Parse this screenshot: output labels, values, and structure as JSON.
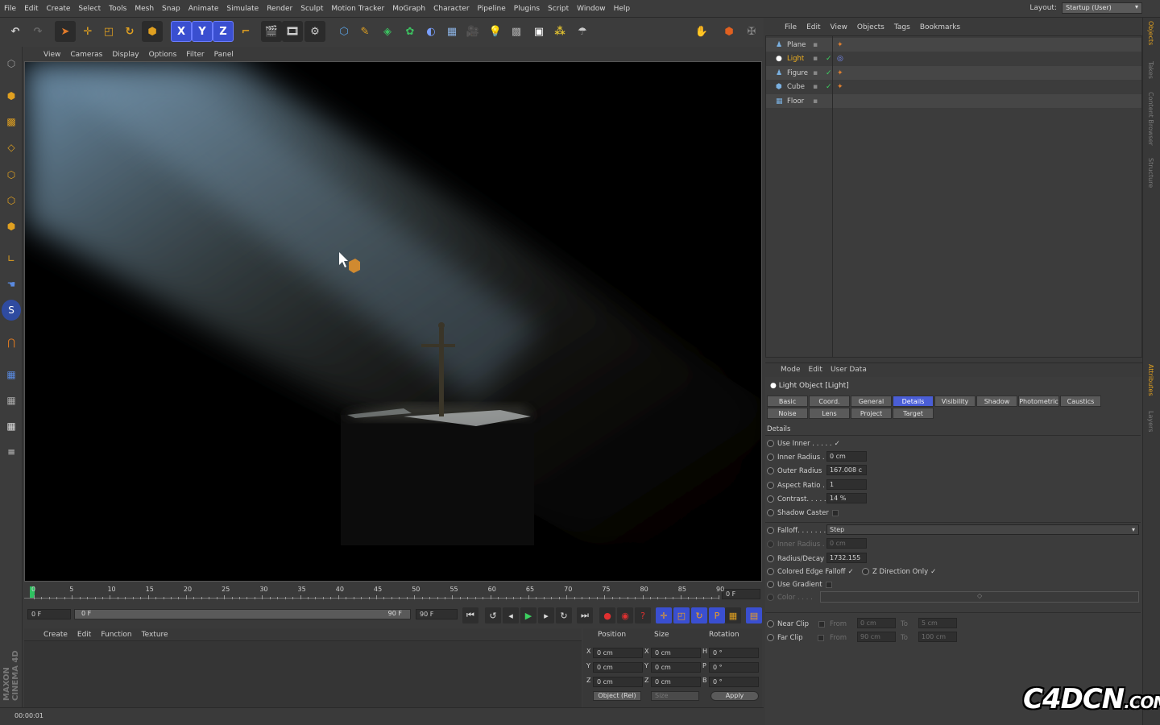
{
  "menubar": [
    "File",
    "Edit",
    "Create",
    "Select",
    "Tools",
    "Mesh",
    "Snap",
    "Animate",
    "Simulate",
    "Render",
    "Sculpt",
    "Motion Tracker",
    "MoGraph",
    "Character",
    "Pipeline",
    "Plugins",
    "Script",
    "Window",
    "Help"
  ],
  "layout": {
    "label": "Layout:",
    "value": "Startup (User)"
  },
  "toolbar": {
    "x": "X",
    "y": "Y",
    "z": "Z"
  },
  "viewport_menu": [
    "View",
    "Cameras",
    "Display",
    "Options",
    "Filter",
    "Panel"
  ],
  "timeline": {
    "ticks": [
      "0",
      "5",
      "10",
      "15",
      "20",
      "25",
      "30",
      "35",
      "40",
      "45",
      "50",
      "55",
      "60",
      "65",
      "70",
      "75",
      "80",
      "85",
      "90"
    ],
    "end_field": "0 F",
    "start_field": "0 F",
    "range_start": "0 F",
    "range_end": "90 F",
    "max_field": "90 F"
  },
  "material_menu": [
    "Create",
    "Edit",
    "Function",
    "Texture"
  ],
  "coords": {
    "headers": [
      "Position",
      "Size",
      "Rotation"
    ],
    "rows": [
      {
        "axis": "X",
        "pos": "0 cm",
        "size_axis": "X",
        "size": "0 cm",
        "rot_axis": "H",
        "rot": "0 °"
      },
      {
        "axis": "Y",
        "pos": "0 cm",
        "size_axis": "Y",
        "size": "0 cm",
        "rot_axis": "P",
        "rot": "0 °"
      },
      {
        "axis": "Z",
        "pos": "0 cm",
        "size_axis": "Z",
        "size": "0 cm",
        "rot_axis": "B",
        "rot": "0 °"
      }
    ],
    "mode": "Object (Rel)",
    "size_mode": "Size",
    "apply": "Apply"
  },
  "status": "00:00:01",
  "brand": "MAXON CINEMA 4D",
  "object_menu": [
    "File",
    "Edit",
    "View",
    "Objects",
    "Tags",
    "Bookmarks"
  ],
  "objects": [
    {
      "name": "Plane",
      "selected": false
    },
    {
      "name": "Light",
      "selected": true
    },
    {
      "name": "Figure",
      "selected": false
    },
    {
      "name": "Cube",
      "selected": false
    },
    {
      "name": "Floor",
      "selected": false
    }
  ],
  "attr_menu": [
    "Mode",
    "Edit",
    "User Data"
  ],
  "attr": {
    "title": "Light Object [Light]",
    "tabs_row1": [
      "Basic",
      "Coord.",
      "General",
      "Details",
      "Visibility",
      "Shadow",
      "Photometric",
      "Caustics"
    ],
    "tabs_row2": [
      "Noise",
      "Lens",
      "Project",
      "Target"
    ],
    "active_tab": "Details",
    "section": "Details",
    "props": {
      "use_inner": "Use Inner . . . . .",
      "inner_radius": "Inner Radius . .",
      "inner_radius_val": "0 cm",
      "outer_radius": "Outer Radius",
      "outer_radius_val": "167.008 c",
      "aspect_ratio": "Aspect Ratio . .",
      "aspect_ratio_val": "1",
      "contrast": "Contrast. . . . . .",
      "contrast_val": "14 %",
      "shadow_caster": "Shadow Caster",
      "falloff": "Falloff. . . . . . . .",
      "falloff_val": "Step",
      "inner_radius2": "Inner Radius . .",
      "inner_radius2_val": "0 cm",
      "radius_decay": "Radius/Decay",
      "radius_decay_val": "1732.155",
      "colored_edge": "Colored Edge Falloff",
      "z_direction": "Z Direction Only",
      "use_gradient": "Use Gradient",
      "color": "Color . . . .",
      "near_clip": "Near Clip",
      "far_clip": "Far Clip",
      "from": "From",
      "to": "To",
      "near_from": "0 cm",
      "near_to": "5 cm",
      "far_from": "90 cm",
      "far_to": "100 cm"
    }
  },
  "right_strip": [
    "Objects",
    "Takes",
    "Content Browser",
    "Structure",
    "Attributes",
    "Layers"
  ],
  "watermark": "C4DCN",
  "watermark_sub": ".COM"
}
